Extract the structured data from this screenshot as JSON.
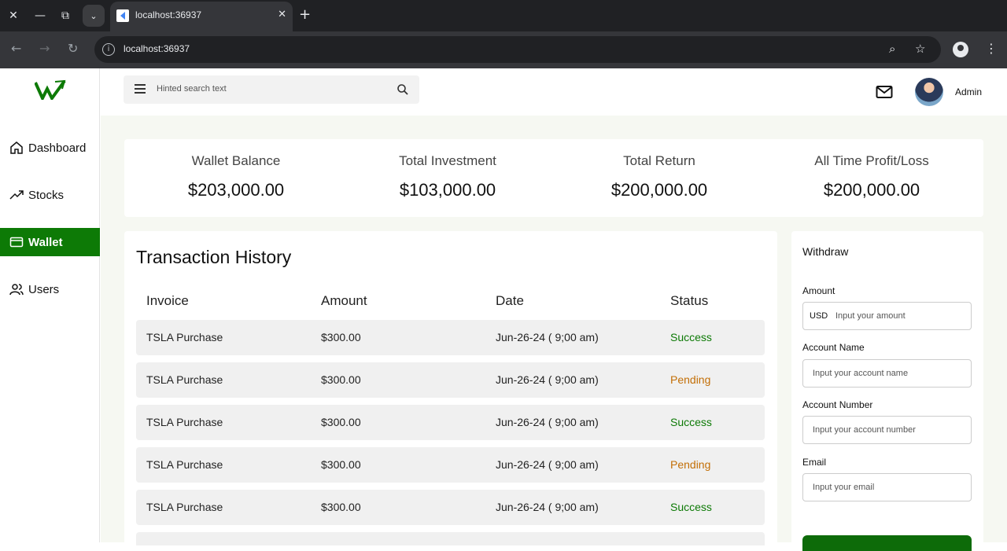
{
  "browser": {
    "tab_title": "localhost:36937",
    "url": "localhost:36937"
  },
  "sidebar": {
    "items": [
      {
        "label": "Dashboard",
        "icon": "home-icon",
        "active": false
      },
      {
        "label": "Stocks",
        "icon": "trending-up-icon",
        "active": false
      },
      {
        "label": "Wallet",
        "icon": "wallet-icon",
        "active": true
      },
      {
        "label": "Users",
        "icon": "users-icon",
        "active": false
      }
    ]
  },
  "header": {
    "search_placeholder": "Hinted search text",
    "user_name": "Admin"
  },
  "stats": [
    {
      "label": "Wallet Balance",
      "value": "$203,000.00"
    },
    {
      "label": "Total Investment",
      "value": "$103,000.00"
    },
    {
      "label": "Total Return",
      "value": "$200,000.00"
    },
    {
      "label": "All Time Profit/Loss",
      "value": "$200,000.00"
    }
  ],
  "history": {
    "title": "Transaction History",
    "columns": [
      "Invoice",
      "Amount",
      "Date",
      "Status"
    ],
    "rows": [
      {
        "invoice": "TSLA Purchase",
        "amount": "$300.00",
        "date": "Jun-26-24 ( 9;00 am)",
        "status": "Success"
      },
      {
        "invoice": "TSLA Purchase",
        "amount": "$300.00",
        "date": "Jun-26-24 ( 9;00 am)",
        "status": "Pending"
      },
      {
        "invoice": "TSLA Purchase",
        "amount": "$300.00",
        "date": "Jun-26-24 ( 9;00 am)",
        "status": "Success"
      },
      {
        "invoice": "TSLA Purchase",
        "amount": "$300.00",
        "date": "Jun-26-24 ( 9;00 am)",
        "status": "Pending"
      },
      {
        "invoice": "TSLA Purchase",
        "amount": "$300.00",
        "date": "Jun-26-24 ( 9;00 am)",
        "status": "Success"
      }
    ]
  },
  "withdraw": {
    "title": "Withdraw",
    "amount_label": "Amount",
    "amount_prefix": "USD",
    "amount_placeholder": "Input your amount",
    "account_name_label": "Account Name",
    "account_name_placeholder": "Input your account name",
    "account_number_label": "Account Number",
    "account_number_placeholder": "Input your account number",
    "email_label": "Email",
    "email_placeholder": "Input your email"
  },
  "colors": {
    "accent": "#0d7a06",
    "success": "#0d7a06",
    "pending": "#c36f07"
  }
}
